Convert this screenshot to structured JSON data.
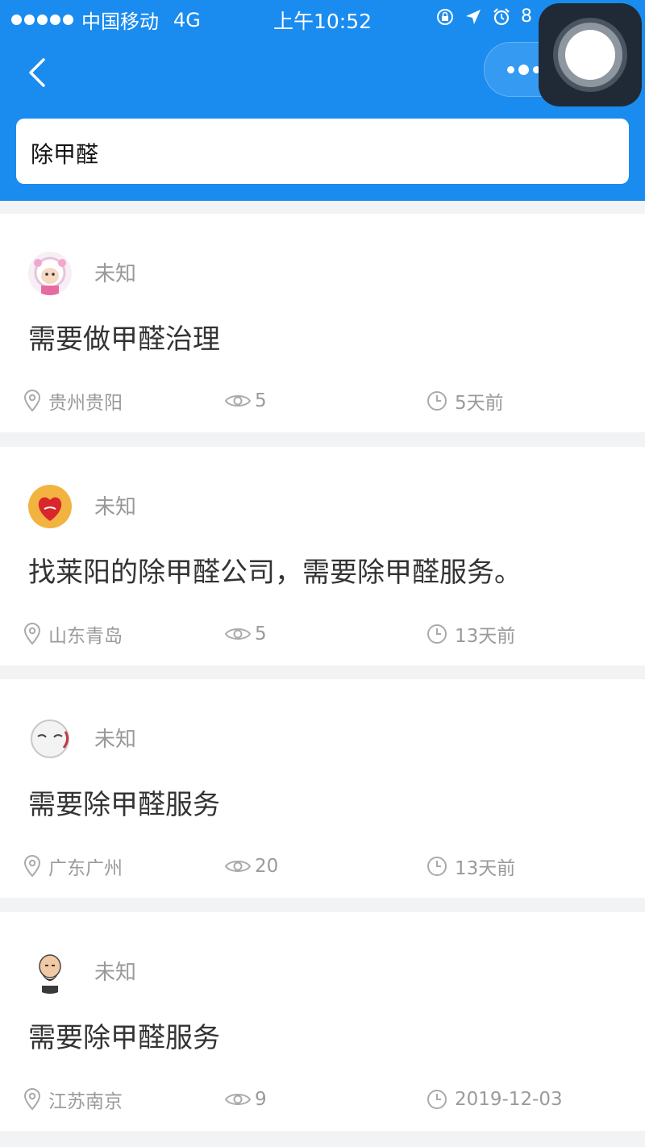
{
  "status_bar": {
    "carrier": "中国移动",
    "network": "4G",
    "time": "上午10:52",
    "battery_partial": "8"
  },
  "search": {
    "value": "除甲醛"
  },
  "colors": {
    "header": "#1a8cf0",
    "meta_text": "#9a9a9a",
    "author_text": "#999999",
    "title_text": "#333333"
  },
  "posts": [
    {
      "author": "未知",
      "title": "需要做甲醛治理",
      "location": "贵州贵阳",
      "views": "5",
      "time": "5天前",
      "avatar": "sheep-cartoon-avatar"
    },
    {
      "author": "未知",
      "title": "找莱阳的除甲醛公司，需要除甲醛服务。",
      "location": "山东青岛",
      "views": "5",
      "time": "13天前",
      "avatar": "red-heart-avatar"
    },
    {
      "author": "未知",
      "title": "需要除甲醛服务",
      "location": "广东广州",
      "views": "20",
      "time": "13天前",
      "avatar": "white-face-avatar"
    },
    {
      "author": "未知",
      "title": "需要除甲醛服务",
      "location": "江苏南京",
      "views": "9",
      "time": "2019-12-03",
      "avatar": "bearded-man-avatar"
    }
  ]
}
